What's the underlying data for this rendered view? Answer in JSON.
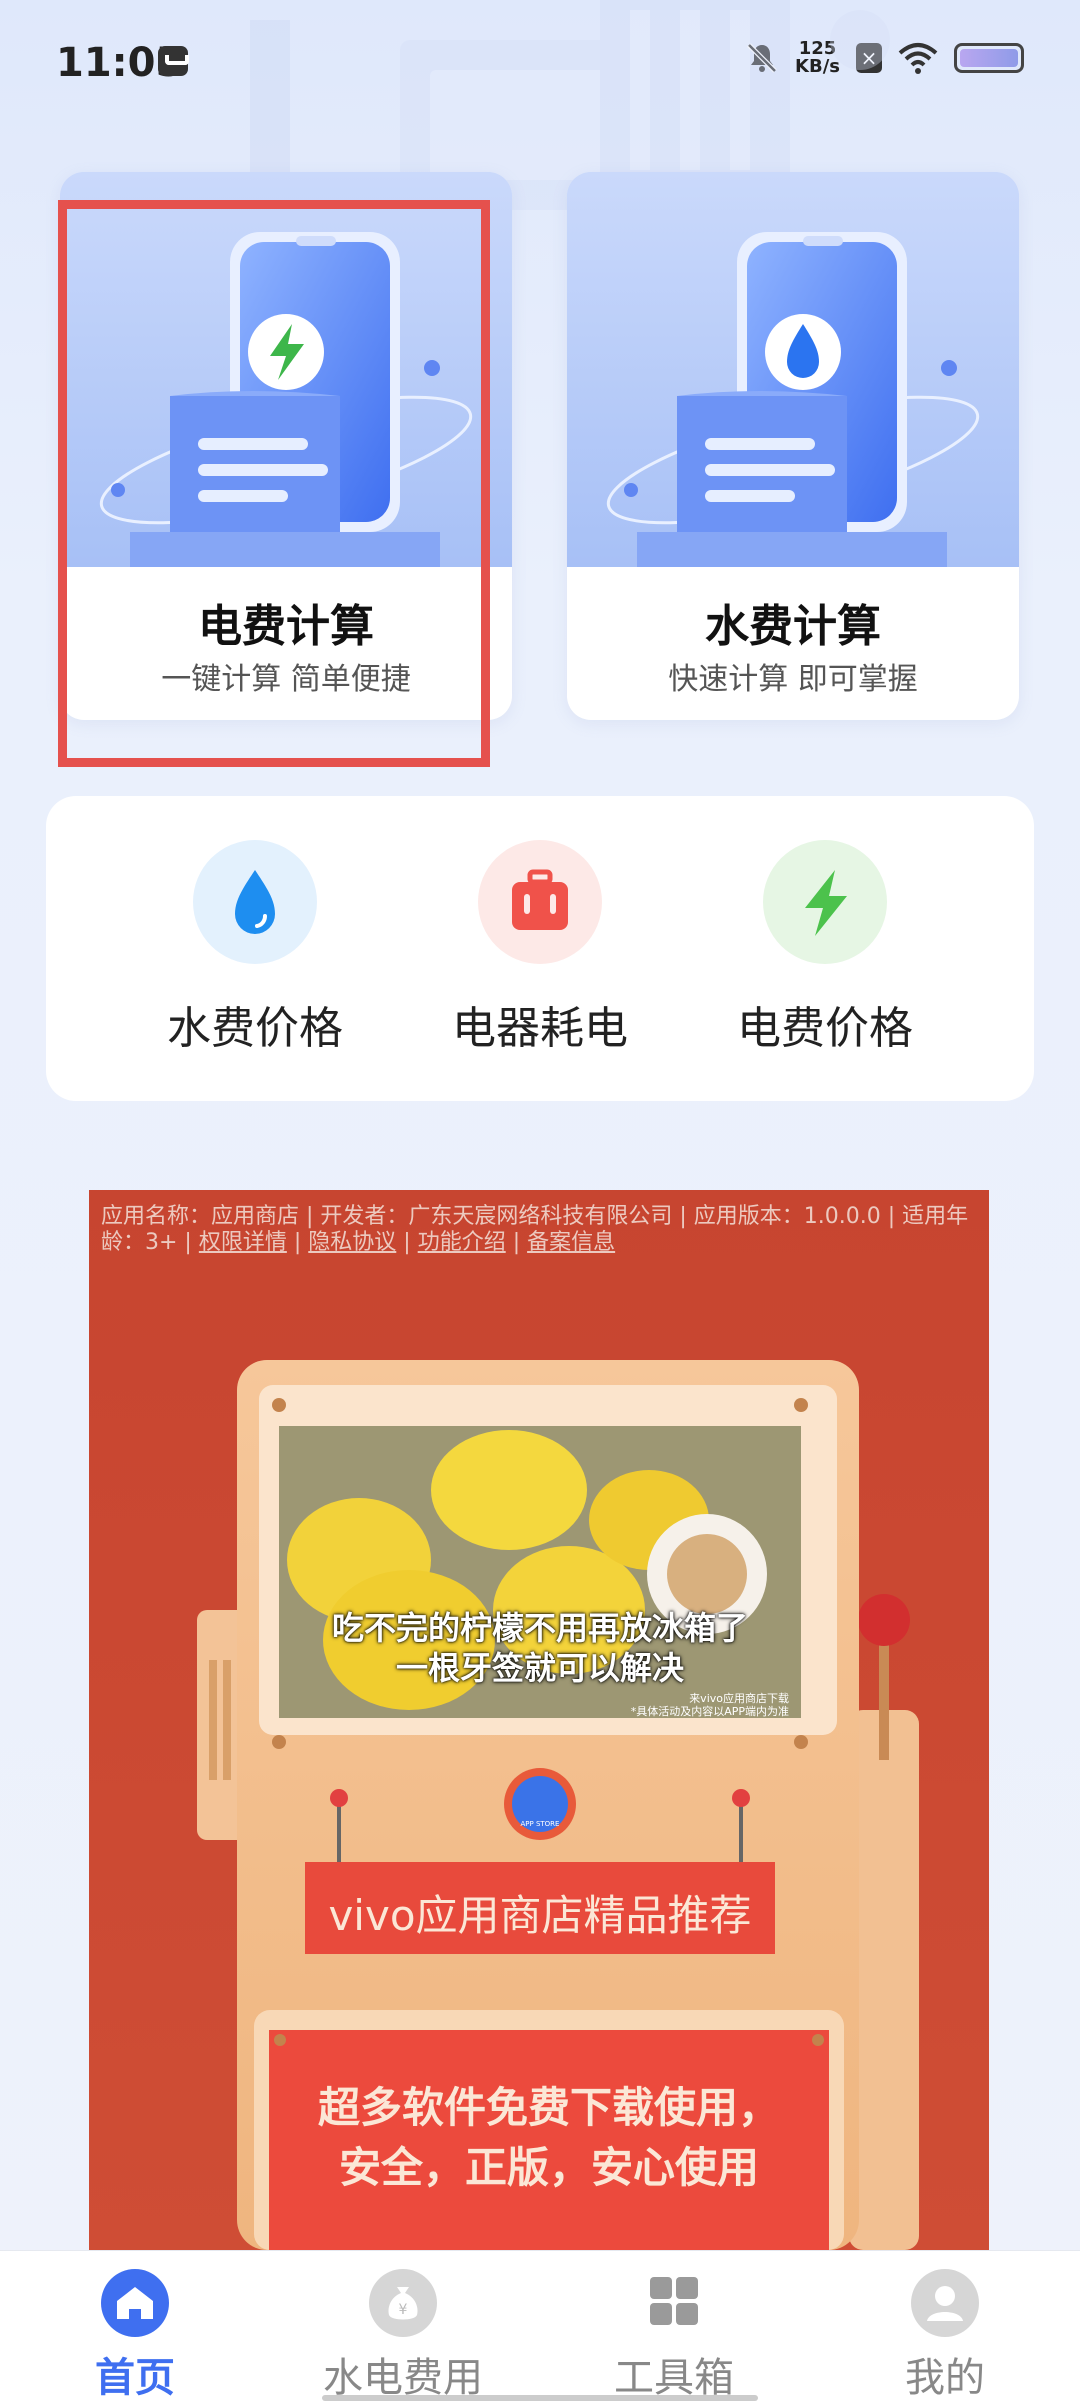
{
  "status_bar": {
    "time": "11:05",
    "speed_value": "125",
    "speed_unit": "KB/s",
    "sim_label": "×"
  },
  "cards": {
    "electricity": {
      "title": "电费计算",
      "subtitle": "一键计算 简单便捷",
      "icon": "lightning-icon"
    },
    "water": {
      "title": "水费计算",
      "subtitle": "快速计算 即可掌握",
      "icon": "water-drop-icon"
    }
  },
  "tools": [
    {
      "label": "水费价格",
      "icon": "water-drop-icon",
      "color": "#1e8ef0"
    },
    {
      "label": "电器耗电",
      "icon": "appliance-icon",
      "color": "#f0524a"
    },
    {
      "label": "电费价格",
      "icon": "lightning-icon",
      "color": "#4cc24c"
    }
  ],
  "ad": {
    "info_line": "应用名称：应用商店 | 开发者：广东天宸网络科技有限公司 | 应用版本：1.0.0.0 | 适用年龄：3+ |",
    "links": [
      "权限详情",
      "隐私协议",
      "功能介绍",
      "备案信息"
    ],
    "screen_caption_1": "吃不完的柠檬不用再放冰箱了",
    "screen_caption_2": "一根牙签就可以解决",
    "screen_note_1": "来vivo应用商店下载",
    "screen_note_2": "*具体活动及内容以APP端内为准",
    "store_badge": "APP STORE",
    "banner": "vivo应用商店精品推荐",
    "panel_line_1": "超多软件免费下载使用，",
    "panel_line_2": "安全，正版，安心使用"
  },
  "bottom_nav": [
    {
      "label": "首页",
      "icon": "home-icon",
      "active": true
    },
    {
      "label": "水电费用",
      "icon": "money-bag-icon",
      "active": false
    },
    {
      "label": "工具箱",
      "icon": "grid-icon",
      "active": false
    },
    {
      "label": "我的",
      "icon": "user-icon",
      "active": false
    }
  ],
  "colors": {
    "accent": "#3f6ff0",
    "highlight_border": "#e5514d",
    "ad_background": "#c84a36"
  }
}
